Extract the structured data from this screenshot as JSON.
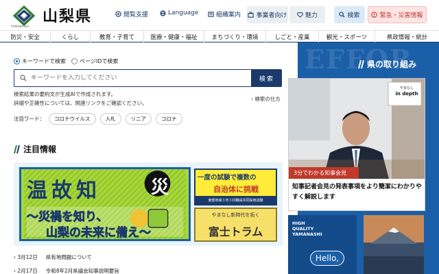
{
  "header": {
    "logo_sub": "YAMANASHI",
    "site_title": "山梨県",
    "links": [
      {
        "label": "閲覧支援",
        "icon": "reading-assist-icon"
      },
      {
        "label": "Language",
        "icon": "globe-icon"
      },
      {
        "label": "組織案内",
        "icon": "organization-icon"
      }
    ],
    "business_label": "事業者向け",
    "charm_label": "魅力",
    "search_label": "検索",
    "emergency_label": "緊急・災害情報",
    "colors": {
      "brand": "#1b3a6b",
      "emergency": "#c0392b",
      "accent": "#1b5fa8"
    }
  },
  "nav": {
    "items": [
      "防災・安全",
      "くらし",
      "教育・子育て",
      "医療・健康・福祉",
      "まちづくり・環境",
      "しごと・産業",
      "観光・スポーツ",
      "県政情報・統計"
    ]
  },
  "search": {
    "radio_keyword": "キーワードで検索",
    "radio_pageid": "ページIDで検索",
    "placeholder": "キーワードを入力してください",
    "button": "検索",
    "note1": "検索結果の要約文が生成AIで作成されます。",
    "note2": "詳細や正確性については、関連リンクをご確認ください。",
    "howto": "検索の仕方",
    "attention_label": "注目ワード：",
    "tags": [
      "コロナウイルス",
      "入札",
      "リニア",
      "コロナ"
    ]
  },
  "featured": {
    "title": "注目情報",
    "banner1": {
      "big_chars": [
        "温",
        "故",
        "知",
        "災"
      ],
      "line1": "〜災禍を知り、",
      "line2": "山梨の未来に備え〜"
    },
    "banner2": {
      "line1": "一度の試験で複数の",
      "line2": "自治体に挑戦",
      "line3": "東部地域３市３村職員共同採用試験"
    },
    "banner3": {
      "line1": "やまなし新時代を拓く",
      "line2": "富士トラム"
    },
    "news": [
      {
        "date": "3月12日",
        "title": "県有地問題について"
      },
      {
        "date": "2月17日",
        "title": "令和8年2月県議会知事説明要旨"
      }
    ]
  },
  "right": {
    "bg_text": "EFFOR",
    "title": "県の取り組み",
    "sign_line1": "やまなし",
    "sign_line2": "in depth",
    "red_label": "3分でわかる知事会見",
    "desc": "知事記者会見の発表事項をより簡潔にわかりやすく解説します",
    "hq_line1": "HIGH",
    "hq_line2": "QUALITY",
    "hq_line3": "YAMANASHI",
    "hello": "Hello,"
  }
}
